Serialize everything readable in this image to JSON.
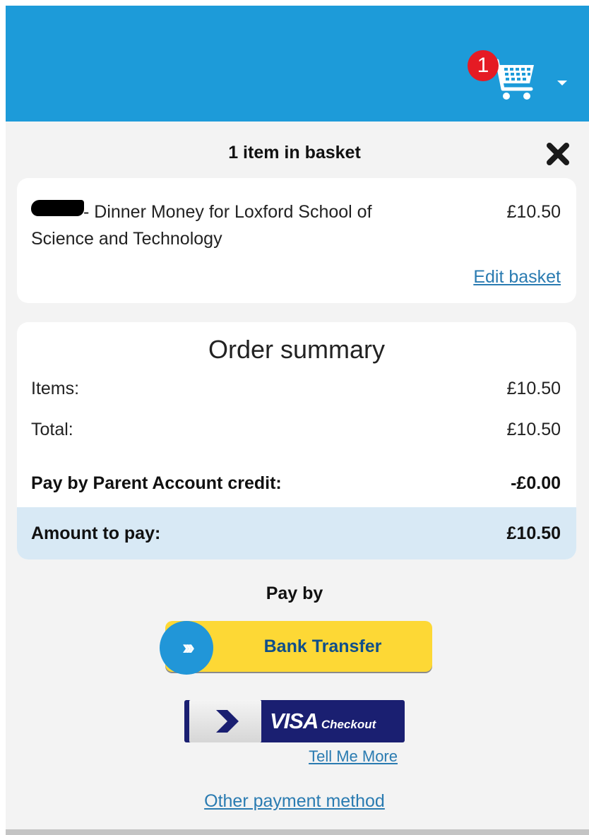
{
  "header": {
    "cart_count": "1"
  },
  "basket": {
    "title": "1 item in basket",
    "item_description": "- Dinner Money for Loxford School of Science and Technology",
    "item_price": "£10.50",
    "edit_link": "Edit basket"
  },
  "summary": {
    "title": "Order summary",
    "items_label": "Items:",
    "items_value": "£10.50",
    "total_label": "Total:",
    "total_value": "£10.50",
    "credit_label": "Pay by Parent Account credit:",
    "credit_value": "-£0.00",
    "amount_label": "Amount to pay:",
    "amount_value": "£10.50"
  },
  "payment": {
    "pay_by_label": "Pay by",
    "bank_transfer_label": "Bank Transfer",
    "visa_brand": "VISA",
    "visa_checkout": "Checkout",
    "tell_me_more": "Tell Me More",
    "other_method": "Other payment method"
  },
  "colors": {
    "header_blue": "#1d9bd9",
    "badge_red": "#e51b24",
    "bank_yellow": "#fdd835",
    "visa_navy": "#1a1f71",
    "link_blue": "#2a7bb1",
    "amount_band": "#d8e9f5"
  },
  "icons": {
    "cart": "shopping-cart-icon",
    "close": "close-icon",
    "caret": "chevron-down-icon",
    "bank": "fast-forward-icon",
    "visa": "chevron-right-icon"
  }
}
